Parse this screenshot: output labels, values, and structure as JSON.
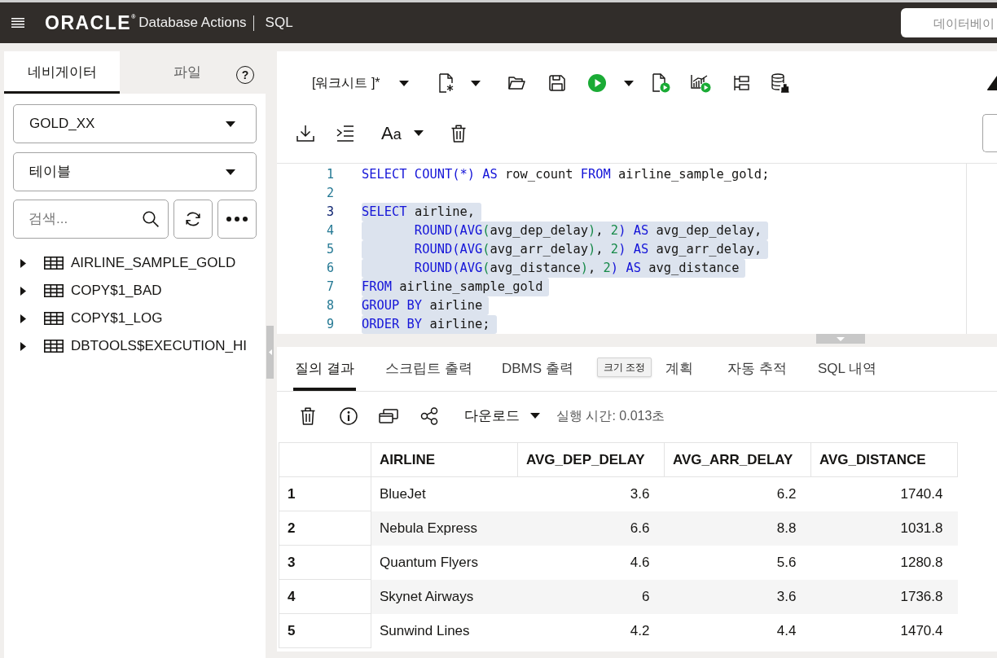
{
  "header": {
    "logo": "ORACLE$^{®}$",
    "app_name": "Database Actions",
    "page": "SQL",
    "search": {
      "placeholder": "데이터베이"
    }
  },
  "navigator": {
    "tabs": [
      {
        "label": "네비게이터",
        "selected": true
      },
      {
        "label": "파일",
        "selected": false
      }
    ],
    "help": "?",
    "schema": "GOLD_XX",
    "object_type": "테이블",
    "search": {
      "placeholder": "검색..."
    },
    "tree": [
      {
        "label": "AIRLINE_SAMPLE_GOLD",
        "expanded": false
      },
      {
        "label": "COPY$1_BAD",
        "expanded": false
      },
      {
        "label": "COPY$1_LOG",
        "expanded": false
      },
      {
        "label": "DBTOOLS$EXECUTION_HI",
        "expanded": false
      }
    ]
  },
  "worksheet": {
    "menu": "[워크시트 ]*",
    "font_menu": "Aa",
    "editor": {
      "lines": [
        {
          "number": "1",
          "selected": false,
          "current": false,
          "tokens": [
            {
              "kind": "keyword",
              "text": "SELECT COUNT(*) AS"
            },
            {
              "kind": "plain",
              "text": " row_count "
            },
            {
              "kind": "keyword",
              "text": "FROM"
            },
            {
              "kind": "plain",
              "text": " airline_sample_gold;"
            }
          ]
        },
        {
          "number": "2",
          "selected": false,
          "current": false
        },
        {
          "number": "3",
          "selected": true,
          "current": true,
          "tokens": [
            {
              "kind": "keyword",
              "text": "SELECT"
            },
            {
              "kind": "plain",
              "text": " airline,"
            }
          ]
        },
        {
          "number": "4",
          "selected": true,
          "current": false,
          "tokens": [
            {
              "kind": "keyword",
              "text": "       ROUND(AVG"
            },
            {
              "kind": "bracket",
              "text": "("
            },
            {
              "kind": "plain",
              "text": "avg_dep_delay"
            },
            {
              "kind": "bracket",
              "text": ")"
            },
            {
              "kind": "plain",
              "text": ", "
            },
            {
              "kind": "number",
              "text": "2"
            },
            {
              "kind": "keyword",
              "text": ") AS"
            },
            {
              "kind": "plain",
              "text": " avg_dep_delay,"
            }
          ]
        },
        {
          "number": "5",
          "selected": true,
          "current": false,
          "tokens": [
            {
              "kind": "keyword",
              "text": "       ROUND(AVG"
            },
            {
              "kind": "bracket",
              "text": "("
            },
            {
              "kind": "plain",
              "text": "avg_arr_delay"
            },
            {
              "kind": "bracket",
              "text": ")"
            },
            {
              "kind": "plain",
              "text": ", "
            },
            {
              "kind": "number",
              "text": "2"
            },
            {
              "kind": "keyword",
              "text": ") AS"
            },
            {
              "kind": "plain",
              "text": " avg_arr_delay,"
            }
          ]
        },
        {
          "number": "6",
          "selected": true,
          "current": false,
          "tokens": [
            {
              "kind": "keyword",
              "text": "       ROUND(AVG"
            },
            {
              "kind": "bracket",
              "text": "("
            },
            {
              "kind": "plain",
              "text": "avg_distance"
            },
            {
              "kind": "bracket",
              "text": ")"
            },
            {
              "kind": "plain",
              "text": ", "
            },
            {
              "kind": "number",
              "text": "2"
            },
            {
              "kind": "keyword",
              "text": ") AS"
            },
            {
              "kind": "plain",
              "text": " avg_distance"
            }
          ]
        },
        {
          "number": "7",
          "selected": true,
          "current": false,
          "tokens": [
            {
              "kind": "keyword",
              "text": "FROM"
            },
            {
              "kind": "plain",
              "text": " airline_sample_gold"
            }
          ]
        },
        {
          "number": "8",
          "selected": true,
          "current": false,
          "tokens": [
            {
              "kind": "keyword",
              "text": "GROUP BY"
            },
            {
              "kind": "plain",
              "text": " airline"
            }
          ]
        },
        {
          "number": "9",
          "selected": true,
          "current": false,
          "tokens": [
            {
              "kind": "keyword",
              "text": "ORDER BY"
            },
            {
              "kind": "plain",
              "text": " airline;"
            }
          ]
        }
      ]
    }
  },
  "results": {
    "tabs": [
      {
        "label": "질의 결과",
        "selected": true
      },
      {
        "label": "스크립트 출력",
        "selected": false
      },
      {
        "label": "DBMS 출력",
        "selected": false
      },
      {
        "label": "계획",
        "selected": false
      },
      {
        "label": "자동 추적",
        "selected": false
      },
      {
        "label": "SQL 내역",
        "selected": false
      }
    ],
    "tooltip": "크기 조정",
    "download": "다운로드",
    "execution_time": "실행 시간: 0.013초",
    "table": {
      "columns": [
        {
          "label": "AIRLINE",
          "numeric": false
        },
        {
          "label": "AVG_DEP_DELAY",
          "numeric": true
        },
        {
          "label": "AVG_ARR_DELAY",
          "numeric": true
        },
        {
          "label": "AVG_DISTANCE",
          "numeric": true
        }
      ],
      "rows": [
        {
          "number": "1",
          "cells": [
            "BlueJet",
            "3.6",
            "6.2",
            "1740.4"
          ]
        },
        {
          "number": "2",
          "cells": [
            "Nebula Express",
            "6.6",
            "8.8",
            "1031.8"
          ]
        },
        {
          "number": "3",
          "cells": [
            "Quantum Flyers",
            "4.6",
            "5.6",
            "1280.8"
          ]
        },
        {
          "number": "4",
          "cells": [
            "Skynet Airways",
            "6",
            "3.6",
            "1736.8"
          ]
        },
        {
          "number": "5",
          "cells": [
            "Sunwind Lines",
            "4.2",
            "4.4",
            "1470.4"
          ]
        }
      ]
    }
  }
}
